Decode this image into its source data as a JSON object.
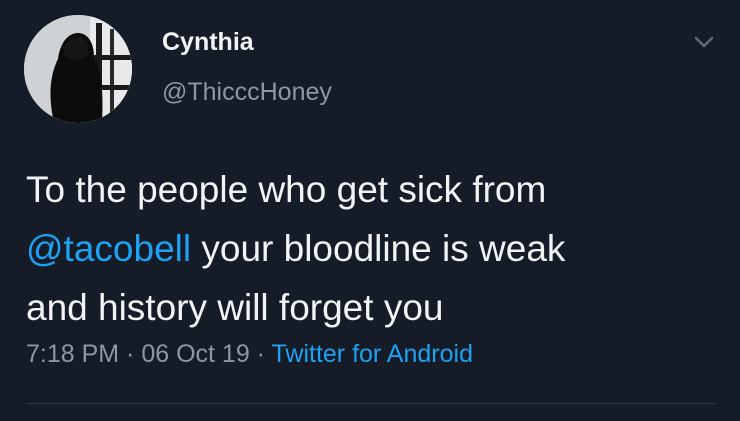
{
  "tweet": {
    "author": {
      "display_name": "Cynthia",
      "handle": "@ThicccHoney",
      "avatar_icon": "profile-avatar"
    },
    "body": {
      "line1": "To the people who get sick from",
      "mention": "@tacobell",
      "line2_rest": " your bloodline is weak",
      "line3": "and history will forget you"
    },
    "meta": {
      "time": "7:18 PM",
      "separator": " · ",
      "date": "06 Oct 19",
      "source": "Twitter for Android"
    },
    "menu_icon": "chevron-down-icon",
    "colors": {
      "background": "#151c27",
      "text": "#f2f3f5",
      "secondary": "#8b97a3",
      "link": "#1da1f2"
    }
  }
}
